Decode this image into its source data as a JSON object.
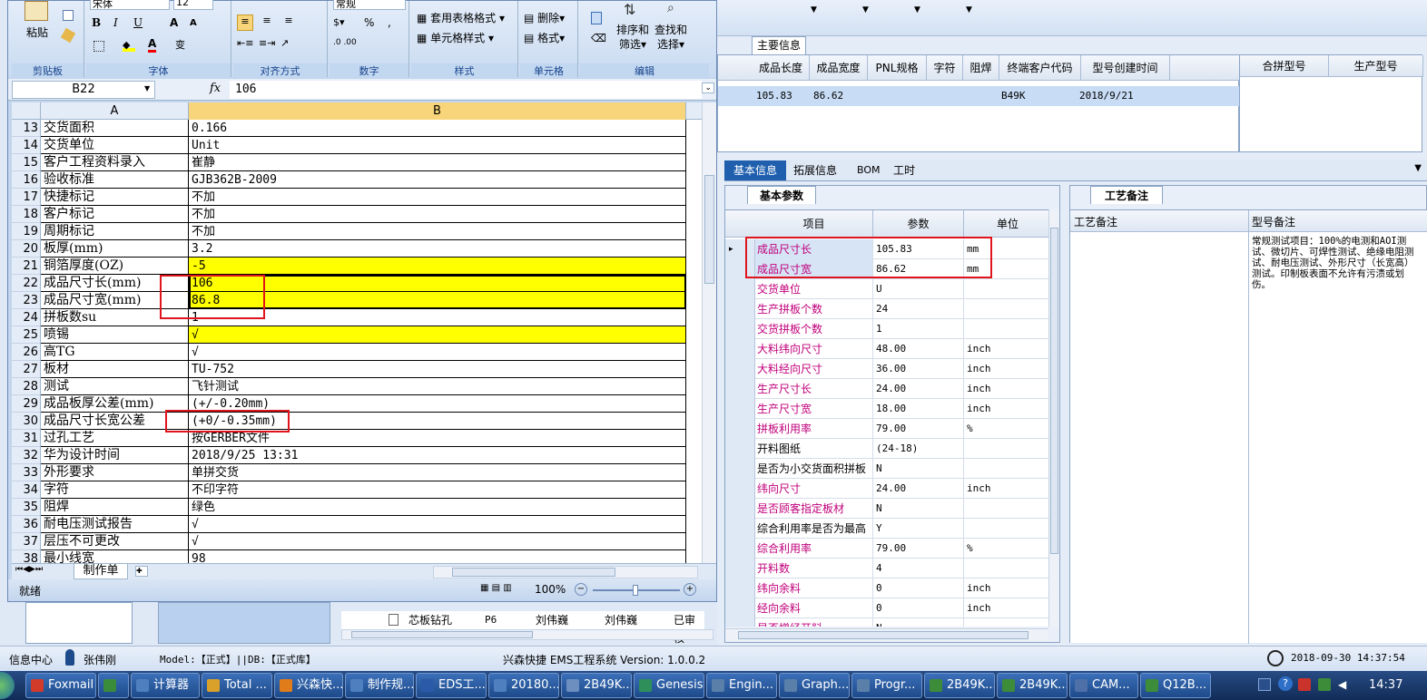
{
  "excel": {
    "clipboard_label": "剪贴板",
    "paste_label": "粘贴",
    "font_label": "字体",
    "align_label": "对齐方式",
    "number_label": "数字",
    "styles_label": "样式",
    "cells_label": "单元格",
    "edit_label": "编辑",
    "font_name": "宋体",
    "font_size": "12",
    "number_format": "常规",
    "table_format": "套用表格格式",
    "cell_style": "单元格样式",
    "delete": "删除",
    "format": "格式",
    "sort_filter_1": "排序和",
    "sort_filter_2": "筛选",
    "find_select_1": "查找和",
    "find_select_2": "选择",
    "name_box": "B22",
    "fx": "fx",
    "formula_value": "106",
    "col_a": "A",
    "col_b": "B",
    "rows": [
      {
        "n": "13",
        "a": "交货面积",
        "b": "0.166",
        "hl": false
      },
      {
        "n": "14",
        "a": "交货单位",
        "b": "Unit",
        "hl": false
      },
      {
        "n": "15",
        "a": "客户工程资料录入",
        "b": "崔静",
        "hl": false
      },
      {
        "n": "16",
        "a": "验收标准",
        "b": "GJB362B-2009",
        "hl": false
      },
      {
        "n": "17",
        "a": "快捷标记",
        "b": "不加",
        "hl": false
      },
      {
        "n": "18",
        "a": "客户标记",
        "b": "不加",
        "hl": false
      },
      {
        "n": "19",
        "a": "周期标记",
        "b": "不加",
        "hl": false
      },
      {
        "n": "20",
        "a": "板厚(mm)",
        "b": "3.2",
        "hl": false
      },
      {
        "n": "21",
        "a": "铜箔厚度(OZ)",
        "b": "-5",
        "hl": true
      },
      {
        "n": "22",
        "a": "成品尺寸长(mm)",
        "b": "106",
        "hl": true
      },
      {
        "n": "23",
        "a": "成品尺寸宽(mm)",
        "b": "86.8",
        "hl": true
      },
      {
        "n": "24",
        "a": "拼板数su",
        "b": "1",
        "hl": false
      },
      {
        "n": "25",
        "a": "喷锡",
        "b": "√",
        "hl": true
      },
      {
        "n": "26",
        "a": "高TG",
        "b": "√",
        "hl": false
      },
      {
        "n": "27",
        "a": "板材",
        "b": "TU-752",
        "hl": false
      },
      {
        "n": "28",
        "a": "测试",
        "b": "飞针测试",
        "hl": false
      },
      {
        "n": "29",
        "a": "成品板厚公差(mm)",
        "b": "(+/-0.20mm)",
        "hl": false
      },
      {
        "n": "30",
        "a": "成品尺寸长宽公差",
        "b": "(+0/-0.35mm)",
        "hl": false
      },
      {
        "n": "31",
        "a": "过孔工艺",
        "b": "按GERBER文件",
        "hl": false
      },
      {
        "n": "32",
        "a": "华为设计时间",
        "b": "2018/9/25 13:31",
        "hl": false
      },
      {
        "n": "33",
        "a": "外形要求",
        "b": "单拼交货",
        "hl": false
      },
      {
        "n": "34",
        "a": "字符",
        "b": "不印字符",
        "hl": false
      },
      {
        "n": "35",
        "a": "阻焊",
        "b": "绿色",
        "hl": false
      },
      {
        "n": "36",
        "a": "耐电压测试报告",
        "b": "√",
        "hl": false
      },
      {
        "n": "37",
        "a": "层压不可更改",
        "b": "√",
        "hl": false
      },
      {
        "n": "38",
        "a": "最小线宽",
        "b": "98",
        "hl": false
      }
    ],
    "sheet_tab": "制作单",
    "status": "就绪",
    "zoom": "100%"
  },
  "app": {
    "main_info_tab": "主要信息",
    "headers": [
      "成品长度",
      "成品宽度",
      "PNL规格",
      "字符",
      "阻焊",
      "终端客户代码",
      "型号创建时间"
    ],
    "row": [
      "105.83",
      "86.62",
      "",
      "",
      "",
      "B49K",
      "2018/9/21"
    ],
    "right_headers": [
      "合拼型号",
      "生产型号"
    ],
    "tabs": [
      "基本信息",
      "拓展信息",
      "BOM",
      "工时"
    ],
    "basic_params_tab": "基本参数",
    "process_note_tab": "工艺备注",
    "grid_headers": [
      "项目",
      "参数",
      "单位"
    ],
    "params": [
      {
        "item": "成品尺寸长",
        "val": "105.83",
        "unit": "mm",
        "mag": true
      },
      {
        "item": "成品尺寸宽",
        "val": "86.62",
        "unit": "mm",
        "mag": true
      },
      {
        "item": "交货单位",
        "val": "U",
        "unit": "",
        "mag": true
      },
      {
        "item": "生产拼板个数",
        "val": "24",
        "unit": "",
        "mag": true
      },
      {
        "item": "交货拼板个数",
        "val": "1",
        "unit": "",
        "mag": true
      },
      {
        "item": "大料纬向尺寸",
        "val": "48.00",
        "unit": "inch",
        "mag": true
      },
      {
        "item": "大料经向尺寸",
        "val": "36.00",
        "unit": "inch",
        "mag": true
      },
      {
        "item": "生产尺寸长",
        "val": "24.00",
        "unit": "inch",
        "mag": true
      },
      {
        "item": "生产尺寸宽",
        "val": "18.00",
        "unit": "inch",
        "mag": true
      },
      {
        "item": "拼板利用率",
        "val": "79.00",
        "unit": "%",
        "mag": true
      },
      {
        "item": "开料图纸",
        "val": "(24-18)",
        "unit": "",
        "mag": false
      },
      {
        "item": "是否为小交货面积拼板",
        "val": "N",
        "unit": "",
        "mag": false
      },
      {
        "item": "纬向尺寸",
        "val": "24.00",
        "unit": "inch",
        "mag": true
      },
      {
        "item": "是否顾客指定板材",
        "val": "N",
        "unit": "",
        "mag": true
      },
      {
        "item": "综合利用率是否为最高",
        "val": "Y",
        "unit": "",
        "mag": false
      },
      {
        "item": "综合利用率",
        "val": "79.00",
        "unit": "%",
        "mag": true
      },
      {
        "item": "开料数",
        "val": "4",
        "unit": "",
        "mag": true
      },
      {
        "item": "纬向余料",
        "val": "0",
        "unit": "inch",
        "mag": true
      },
      {
        "item": "经向余料",
        "val": "0",
        "unit": "inch",
        "mag": true
      },
      {
        "item": "是否增经开料",
        "val": "N",
        "unit": "",
        "mag": true
      }
    ],
    "note_headers": [
      "工艺备注",
      "型号备注"
    ],
    "model_note": "常规测试项目：100%的电测和AOI测试、微切片、可焊性测试、绝缘电阻测试、耐电压测试、外形尺寸（长宽高）测试。印制板表面不允许有污渍或划伤。",
    "tree_row": [
      "芯板钻孔",
      "P6",
      "刘伟巍",
      "刘伟巍",
      "已审核"
    ]
  },
  "status_bar": {
    "info_center": "信息中心",
    "user": "张伟刚",
    "model": "Model:【正式】||DB:【正式库】",
    "system": "兴森快捷 EMS工程系统 Version: 1.0.0.2",
    "datetime": "2018-09-30 14:37:54"
  },
  "taskbar": {
    "items": [
      "Foxmail",
      "",
      "计算器",
      "Total ...",
      "兴森快...",
      "制作规...",
      "EDS工...",
      "20180...",
      "2B49K...",
      "Genesis",
      "Engin...",
      "Graph...",
      "Progr...",
      "2B49K...",
      "2B49K...",
      "CAM...",
      "Q12B..."
    ],
    "clock": "14:37"
  }
}
